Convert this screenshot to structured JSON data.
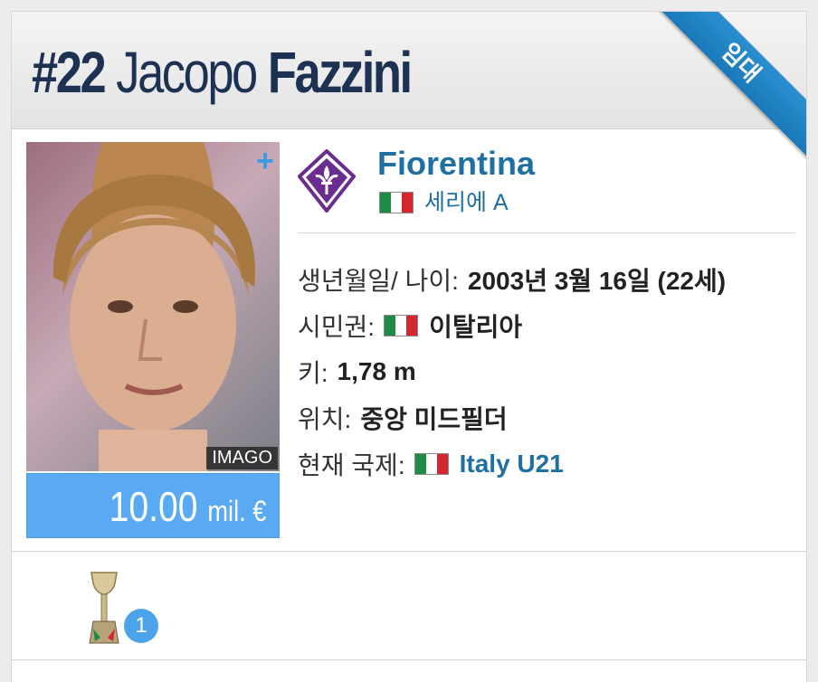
{
  "header": {
    "number": "#22",
    "first_name": "Jacopo",
    "last_name": "Fazzini",
    "ribbon": "임대"
  },
  "photo": {
    "credit": "IMAGO",
    "plus_icon": "plus-icon"
  },
  "market_value": {
    "amount": "10.00",
    "unit": "mil. €"
  },
  "club": {
    "name": "Fiorentina",
    "league": "세리에 A",
    "logo_icon": "fiorentina-crest-icon",
    "colors": {
      "crest_purple": "#6a2d8f",
      "link": "#1f6fa3"
    }
  },
  "info": [
    {
      "label": "생년월일/ 나이:",
      "value": "2003년 3월 16일 (22세)",
      "flag": false,
      "link": false
    },
    {
      "label": "시민권:",
      "value": "이탈리아",
      "flag": true,
      "link": false
    },
    {
      "label": "키:",
      "value": "1,78 m",
      "flag": false,
      "link": false
    },
    {
      "label": "위치:",
      "value": "중앙 미드필더",
      "flag": false,
      "link": false
    },
    {
      "label": "현재 국제:",
      "value": "Italy U21",
      "flag": true,
      "link": true
    }
  ],
  "trophies": {
    "icon": "trophy-icon",
    "count": "1"
  },
  "colors": {
    "title": "#1d3152",
    "ribbon": "#1a79b8",
    "value_box": "#5aaaf3",
    "badge": "#4da3ea"
  }
}
